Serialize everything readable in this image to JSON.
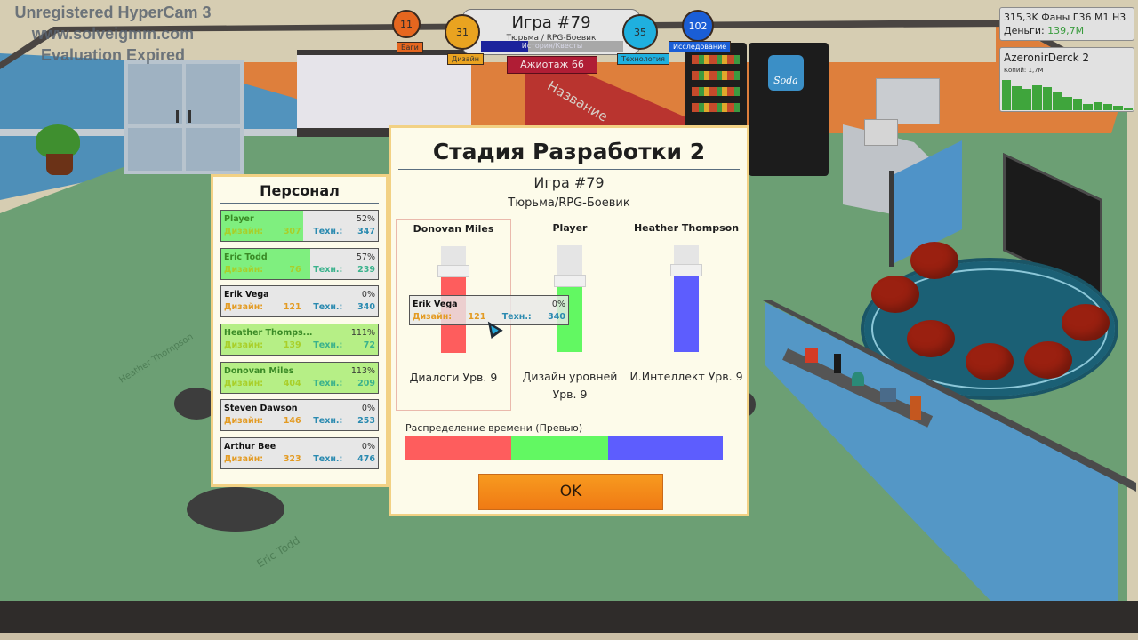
{
  "watermark": {
    "line1": "Unregistered HyperCam 3",
    "line2": "www.solveigmm.com",
    "line3": "Evaluation Expired"
  },
  "hud": {
    "stats": [
      {
        "label": "Баги",
        "value": "11",
        "color": "#e5661f",
        "tag_color": "#e5661f"
      },
      {
        "label": "Дизайн",
        "value": "31",
        "color": "#e9a320",
        "tag_color": "#e9a320"
      },
      {
        "label": "Технология",
        "value": "35",
        "color": "#1fb0df",
        "tag_color": "#1fb0df"
      },
      {
        "label": "Исследование",
        "value": "102",
        "color": "#1a5ed6",
        "tag_color": "#1a5ed6"
      }
    ],
    "project_title": "Игра #79",
    "project_genre": "Тюрьма / RPG-Боевик",
    "progress_label": "История/Квесты",
    "progress_fraction": 0.33,
    "hype_label": "Ажиотаж 66"
  },
  "info": {
    "fans_line": "315,3K Фаны Г36 М1 Н3",
    "money_label": "Деньги:",
    "money_value": "139,7M",
    "game_title": "AzeronirDerck 2",
    "copies_label": "Копий: 1,7М",
    "sales_bars": [
      1.0,
      0.8,
      0.7,
      0.82,
      0.76,
      0.6,
      0.45,
      0.38,
      0.2,
      0.27,
      0.22,
      0.16,
      0.1
    ]
  },
  "staff_panel": {
    "title": "Персонал",
    "design_label": "Дизайн:",
    "tech_label": "Техн.:",
    "members": [
      {
        "name": "Player",
        "percent": "52%",
        "design": "307",
        "tech": "347",
        "progress": 0.52,
        "state": "active"
      },
      {
        "name": "Eric Todd",
        "percent": "57%",
        "design": "76",
        "tech": "239",
        "progress": 0.57,
        "state": "active"
      },
      {
        "name": "Erik Vega",
        "percent": "0%",
        "design": "121",
        "tech": "340",
        "progress": 0,
        "state": "idle"
      },
      {
        "name": "Heather Thomps...",
        "percent": "111%",
        "design": "139",
        "tech": "72",
        "progress": 1.0,
        "state": "boosted"
      },
      {
        "name": "Donovan Miles",
        "percent": "113%",
        "design": "404",
        "tech": "209",
        "progress": 1.0,
        "state": "boosted"
      },
      {
        "name": "Steven Dawson",
        "percent": "0%",
        "design": "146",
        "tech": "253",
        "progress": 0,
        "state": "idle"
      },
      {
        "name": "Arthur Bee",
        "percent": "0%",
        "design": "323",
        "tech": "476",
        "progress": 0,
        "state": "idle"
      }
    ]
  },
  "dev_dialog": {
    "title": "Стадия Разработки 2",
    "game_name": "Игра #79",
    "genre": "Тюрьма/RPG-Боевик",
    "columns": [
      {
        "assignee": "Donovan Miles",
        "feature": "Диалоги Урв. 9",
        "color": "#fe5d5d",
        "level": 0.72,
        "selected": true
      },
      {
        "assignee": "Player",
        "feature": "Дизайн уровней Урв. 9",
        "color": "#62f862",
        "level": 0.62,
        "selected": false
      },
      {
        "assignee": "Heather Thompson",
        "feature": "И.Интеллект Урв. 9",
        "color": "#5d5dfe",
        "level": 0.72,
        "selected": false
      }
    ],
    "time_label": "Распределение времени (Превью)",
    "time_split": [
      0.335,
      0.305,
      0.36
    ],
    "ok_label": "OK"
  },
  "drag_tooltip": {
    "name": "Erik Vega",
    "percent": "0%",
    "design_label": "Дизайн:",
    "design": "121",
    "tech_label": "Техн.:",
    "tech": "340"
  },
  "scene": {
    "wall_sign": "Название",
    "soda_sign": "Soda",
    "floor_labels": [
      "Heather Thompson",
      "Eric Todd"
    ]
  }
}
